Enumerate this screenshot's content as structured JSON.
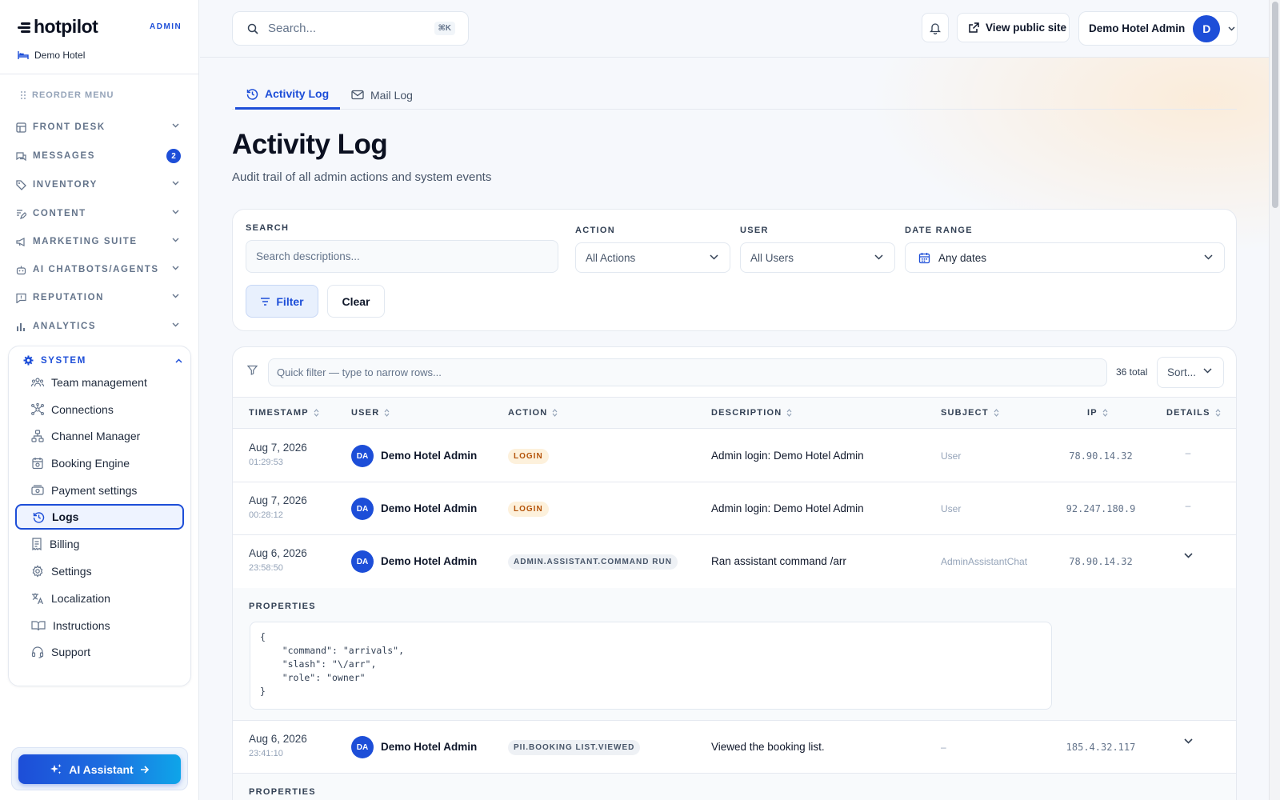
{
  "sidebar": {
    "brand": "hotpilot",
    "admin_label": "ADMIN",
    "hotel": "Demo Hotel",
    "reorder": "REORDER MENU",
    "nav": [
      {
        "label": "FRONT DESK"
      },
      {
        "label": "MESSAGES",
        "badge": "2"
      },
      {
        "label": "INVENTORY"
      },
      {
        "label": "CONTENT"
      },
      {
        "label": "MARKETING SUITE"
      },
      {
        "label": "AI CHATBOTS/AGENTS"
      },
      {
        "label": "REPUTATION"
      },
      {
        "label": "ANALYTICS"
      }
    ],
    "system": {
      "label": "SYSTEM",
      "items": [
        {
          "label": "Team management"
        },
        {
          "label": "Connections"
        },
        {
          "label": "Channel Manager"
        },
        {
          "label": "Booking Engine"
        },
        {
          "label": "Payment settings"
        },
        {
          "label": "Logs"
        },
        {
          "label": "Billing"
        },
        {
          "label": "Settings"
        },
        {
          "label": "Localization"
        },
        {
          "label": "Instructions"
        },
        {
          "label": "Support"
        }
      ]
    },
    "ai_assistant": "AI Assistant"
  },
  "topbar": {
    "search_placeholder": "Search...",
    "shortcut": "⌘K",
    "view_public": "View public site",
    "account_name": "Demo Hotel Admin",
    "account_initial": "D"
  },
  "tabs": [
    {
      "label": "Activity Log"
    },
    {
      "label": "Mail Log"
    }
  ],
  "page": {
    "title": "Activity Log",
    "subtitle": "Audit trail of all admin actions and system events"
  },
  "filters": {
    "search_label": "SEARCH",
    "search_placeholder": "Search descriptions...",
    "action_label": "ACTION",
    "action_value": "All Actions",
    "user_label": "USER",
    "user_value": "All Users",
    "date_label": "DATE RANGE",
    "date_value": "Any dates",
    "filter_btn": "Filter",
    "clear_btn": "Clear"
  },
  "table": {
    "quick_filter_placeholder": "Quick filter — type to narrow rows...",
    "total": "36 total",
    "sort": "Sort...",
    "columns": [
      "TIMESTAMP",
      "USER",
      "ACTION",
      "DESCRIPTION",
      "SUBJECT",
      "IP",
      "DETAILS"
    ],
    "rows": [
      {
        "date": "Aug 7, 2026",
        "time": "01:29:53",
        "initials": "DA",
        "user": "Demo Hotel Admin",
        "action": "LOGIN",
        "description": "Admin login: Demo Hotel Admin",
        "subject": "User",
        "ip": "78.90.14.32",
        "details": "–"
      },
      {
        "date": "Aug 7, 2026",
        "time": "00:28:12",
        "initials": "DA",
        "user": "Demo Hotel Admin",
        "action": "LOGIN",
        "description": "Admin login: Demo Hotel Admin",
        "subject": "User",
        "ip": "92.247.180.9",
        "details": "–"
      },
      {
        "date": "Aug 6, 2026",
        "time": "23:58:50",
        "initials": "DA",
        "user": "Demo Hotel Admin",
        "action": "ADMIN.ASSISTANT.COMMAND RUN",
        "description": "Ran assistant command /arr",
        "subject": "AdminAssistantChat",
        "ip": "78.90.14.32",
        "details": ""
      },
      {
        "date": "Aug 6, 2026",
        "time": "23:41:10",
        "initials": "DA",
        "user": "Demo Hotel Admin",
        "action": "PII.BOOKING LIST.VIEWED",
        "description": "Viewed the booking list.",
        "subject": "–",
        "ip": "185.4.32.117",
        "details": ""
      }
    ],
    "properties_label": "PROPERTIES",
    "properties_json": "{\n    \"command\": \"arrivals\",\n    \"slash\": \"\\/arr\",\n    \"role\": \"owner\"\n}"
  }
}
